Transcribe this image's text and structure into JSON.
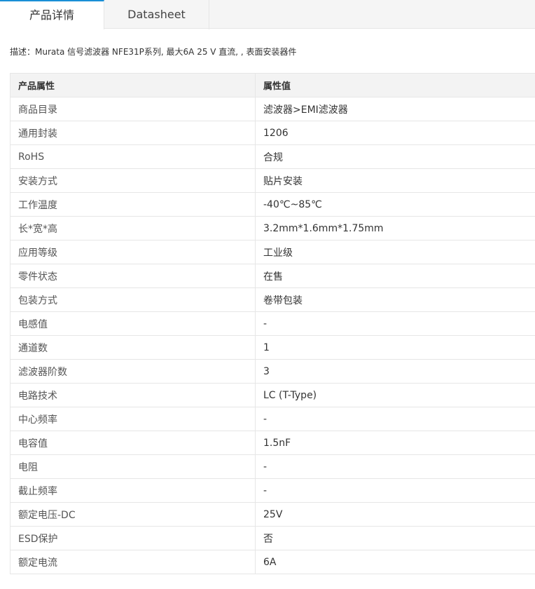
{
  "tabs": [
    {
      "label": "产品详情",
      "active": true
    },
    {
      "label": "Datasheet",
      "active": false
    }
  ],
  "description": "描述：Murata 信号滤波器 NFE31P系列, 最大6A 25 V 直流, , 表面安装器件",
  "table": {
    "headers": [
      "产品属性",
      "属性值"
    ],
    "rows": [
      [
        "商品目录",
        "滤波器>EMI滤波器"
      ],
      [
        "通用封装",
        "1206"
      ],
      [
        "RoHS",
        "合规"
      ],
      [
        "安装方式",
        "贴片安装"
      ],
      [
        "工作温度",
        "-40℃~85℃"
      ],
      [
        "长*宽*高",
        "3.2mm*1.6mm*1.75mm"
      ],
      [
        "应用等级",
        "工业级"
      ],
      [
        "零件状态",
        "在售"
      ],
      [
        "包装方式",
        "卷带包装"
      ],
      [
        "电感值",
        "-"
      ],
      [
        "通道数",
        "1"
      ],
      [
        "滤波器阶数",
        "3"
      ],
      [
        "电路技术",
        "LC (T-Type)"
      ],
      [
        "中心频率",
        "-"
      ],
      [
        "电容值",
        "1.5nF"
      ],
      [
        "电阻",
        "-"
      ],
      [
        "截止频率",
        "-"
      ],
      [
        "额定电压-DC",
        "25V"
      ],
      [
        "ESD保护",
        "否"
      ],
      [
        "额定电流",
        "6A"
      ]
    ]
  },
  "colors": {
    "active_tab_accent": "#1a8fd6",
    "tabbar_bg": "#f5f5f5",
    "header_bg": "#f3f3f3",
    "border": "#e6e6e6"
  }
}
